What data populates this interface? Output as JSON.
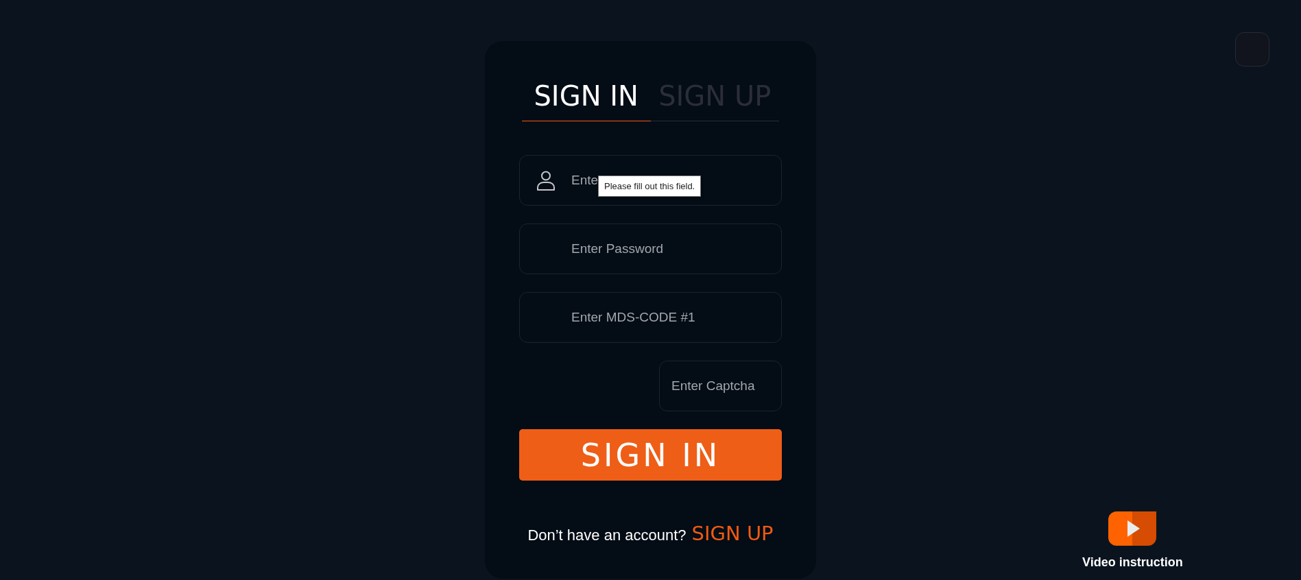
{
  "tabs": [
    {
      "label": "SIGN IN",
      "selected": true
    },
    {
      "label": "SIGN UP",
      "selected": false
    }
  ],
  "fields": [
    {
      "kind": "icon",
      "placeholder": "Ente",
      "tooltip": "Please fill out this field."
    },
    {
      "kind": "plain",
      "placeholder": "Enter Password"
    },
    {
      "kind": "plain",
      "placeholder": "Enter MDS-CODE #1"
    },
    {
      "kind": "captcha",
      "placeholder": "Enter Captcha"
    }
  ],
  "submit_button": "SIGN IN",
  "footer": {
    "text": "Don’t have an account?",
    "link": "SIGN UP"
  },
  "video": {
    "label": "Video instruction"
  }
}
